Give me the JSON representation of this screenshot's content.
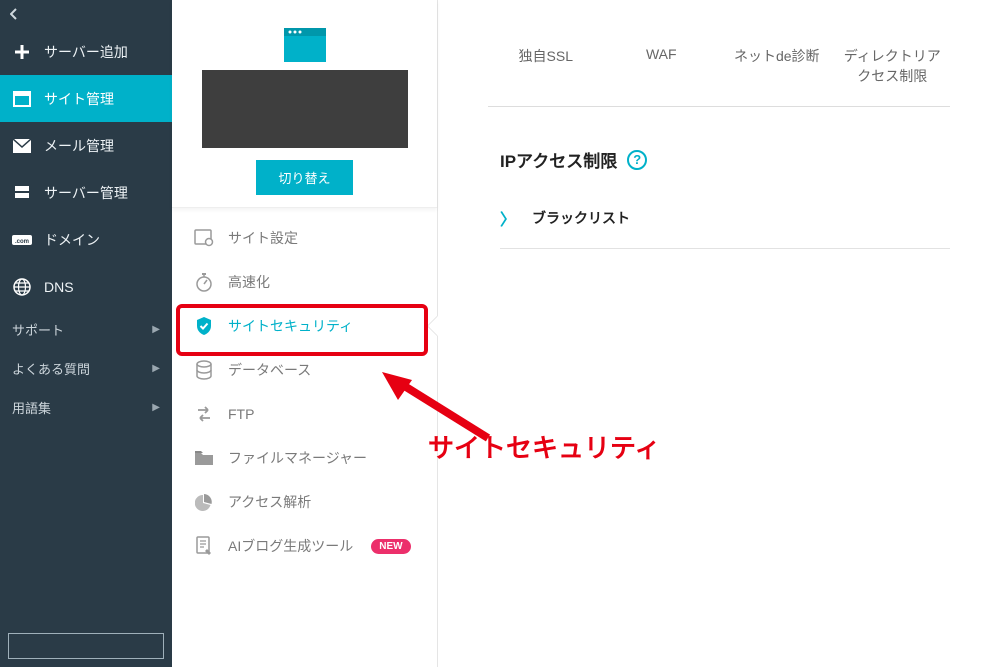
{
  "sidebar": {
    "items": [
      {
        "label": "サーバー追加",
        "icon": "plus"
      },
      {
        "label": "サイト管理",
        "icon": "window"
      },
      {
        "label": "メール管理",
        "icon": "mail"
      },
      {
        "label": "サーバー管理",
        "icon": "server"
      },
      {
        "label": "ドメイン",
        "icon": "domain"
      },
      {
        "label": "DNS",
        "icon": "globe"
      }
    ],
    "support": [
      {
        "label": "サポート"
      },
      {
        "label": "よくある質問"
      },
      {
        "label": "用語集"
      }
    ]
  },
  "mid": {
    "switch_label": "切り替え",
    "items": [
      {
        "label": "サイト設定"
      },
      {
        "label": "高速化"
      },
      {
        "label": "サイトセキュリティ"
      },
      {
        "label": "データベース"
      },
      {
        "label": "FTP"
      },
      {
        "label": "ファイルマネージャー"
      },
      {
        "label": "アクセス解析"
      },
      {
        "label": "AIブログ生成ツール",
        "badge": "NEW"
      }
    ]
  },
  "main": {
    "tabs": [
      {
        "label": "独自SSL"
      },
      {
        "label": "WAF"
      },
      {
        "label": "ネットde診断"
      },
      {
        "label": "ディレクトリアクセス制限"
      }
    ],
    "section_title": "IPアクセス制限",
    "help": "?",
    "blacklist_label": "ブラックリスト"
  },
  "annotation": {
    "label": "サイトセキュリティ"
  }
}
